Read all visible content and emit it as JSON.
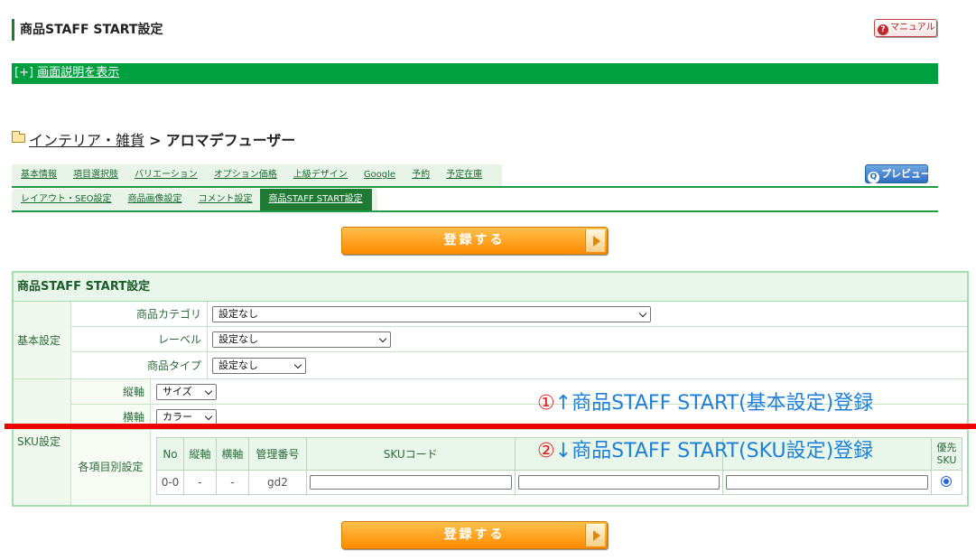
{
  "page": {
    "title": "商品STAFF START設定",
    "manual_label": "マニュアル",
    "desc_prefix": "[+]",
    "desc_link": "画面説明を表示"
  },
  "breadcrumb": {
    "parent": "インテリア・雑貨",
    "separator": ">",
    "current": "アロマデフューザー"
  },
  "tabs": {
    "row1": [
      "基本情報",
      "項目選択肢",
      "バリエーション",
      "オプション価格",
      "上級デザイン",
      "Google",
      "予約",
      "予定在庫"
    ],
    "row2": [
      "レイアウト・SEO設定",
      "商品画像設定",
      "コメント設定",
      "商品STAFF START設定"
    ],
    "active": "商品STAFF START設定",
    "preview_label": "プレビュー"
  },
  "submit_label": "登録する",
  "panel": {
    "header": "商品STAFF START設定",
    "basic_label": "基本設定",
    "basic_rows": [
      {
        "label": "商品カテゴリ",
        "value": "設定なし"
      },
      {
        "label": "レーベル",
        "value": "設定なし"
      },
      {
        "label": "商品タイプ",
        "value": "設定なし"
      }
    ],
    "sku_label": "SKU設定",
    "axis_rows": [
      {
        "label": "縦軸",
        "value": "サイズ"
      },
      {
        "label": "横軸",
        "value": "カラー"
      }
    ],
    "item_label": "各項目別設定",
    "table": {
      "headers": [
        "No",
        "縦軸",
        "横軸",
        "管理番号",
        "SKUコード",
        "",
        "",
        "優先SKU"
      ],
      "rows": [
        {
          "no": "0-0",
          "vertical": "-",
          "horizontal": "-",
          "code": "gd2"
        }
      ]
    }
  },
  "annotations": {
    "top": {
      "num": "①",
      "text": "↑商品STAFF START(基本設定)登録"
    },
    "bottom": {
      "num": "②",
      "text": "↓商品STAFF START(SKU設定)登録"
    },
    "line_color": "#ee0000"
  }
}
